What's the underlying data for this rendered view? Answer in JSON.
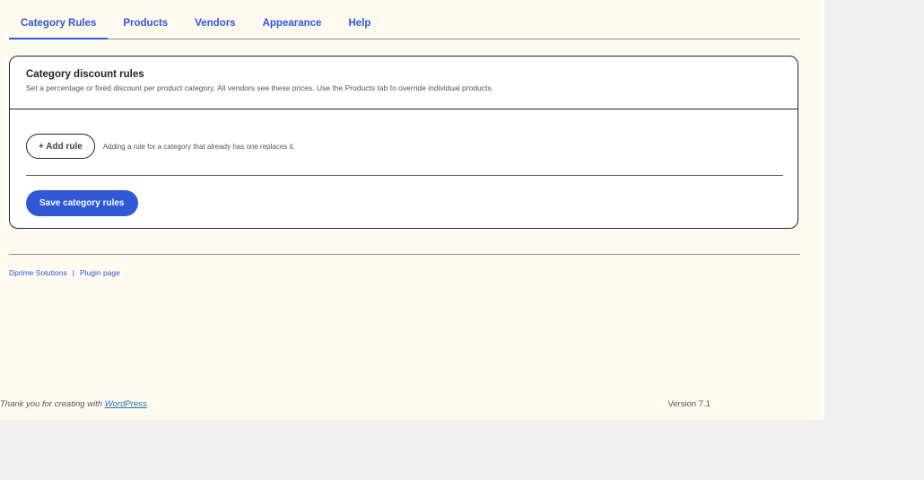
{
  "tabs": [
    {
      "label": "Category Rules",
      "active": true
    },
    {
      "label": "Products",
      "active": false
    },
    {
      "label": "Vendors",
      "active": false
    },
    {
      "label": "Appearance",
      "active": false
    },
    {
      "label": "Help",
      "active": false
    }
  ],
  "card": {
    "title": "Category discount rules",
    "description": "Set a percentage or fixed discount per product category. All vendors see these prices. Use the Products tab to override individual products.",
    "add_button_label": "+ Add rule",
    "add_note": "Adding a rule for a category that already has one replaces it.",
    "save_button_label": "Save category rules"
  },
  "footer": {
    "company_link": "Dprime Solutions",
    "separator": "|",
    "plugin_link": "Plugin page"
  },
  "wp_footer": {
    "thanks_prefix": "Thank you for creating with",
    "wordpress_link": "WordPress",
    "thanks_suffix": ".",
    "version": "Version 7.1"
  },
  "colors": {
    "accent": "#2f57d6",
    "background": "#fffaf0",
    "outer_background": "#f0f0f1"
  }
}
